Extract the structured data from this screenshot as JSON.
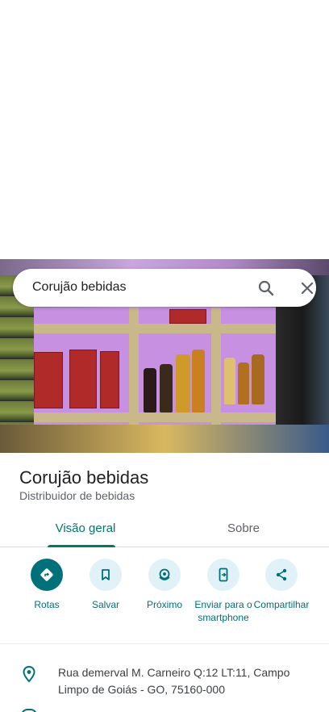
{
  "search": {
    "query": "Corujão bebidas"
  },
  "place": {
    "name": "Corujão bebidas",
    "category": "Distribuidor de bebidas"
  },
  "tabs": [
    {
      "label": "Visão geral",
      "active": true
    },
    {
      "label": "Sobre",
      "active": false
    }
  ],
  "actions": [
    {
      "label": "Rotas",
      "icon": "directions-icon"
    },
    {
      "label": "Salvar",
      "icon": "bookmark-icon"
    },
    {
      "label": "Próximo",
      "icon": "nearby-icon"
    },
    {
      "label": "Enviar para o smartphone",
      "icon": "send-to-phone-icon"
    },
    {
      "label": "Compartilhar",
      "icon": "share-icon"
    }
  ],
  "address": {
    "text": "Rua demerval M. Carneiro Q:12 LT:11, Campo Limpo de Goiás - GO, 75160-000",
    "icon": "location-pin-icon"
  },
  "colors": {
    "accent": "#00707a",
    "tab_active": "#00796b",
    "action_bg": "#e0f2f7"
  }
}
